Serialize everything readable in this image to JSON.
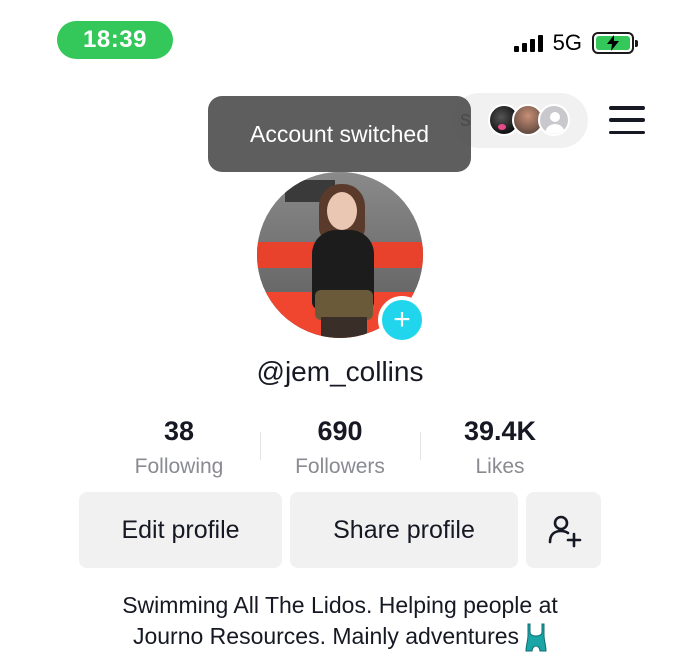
{
  "status_bar": {
    "time": "18:39",
    "network": "5G",
    "time_pill_color": "#34c759",
    "battery_color": "#34c759"
  },
  "header": {
    "account_partial_letter": "s",
    "toast": "Account switched"
  },
  "profile": {
    "username": "@jem_collins",
    "add_color": "#20d5ec"
  },
  "stats": [
    {
      "value": "38",
      "label": "Following"
    },
    {
      "value": "690",
      "label": "Followers"
    },
    {
      "value": "39.4K",
      "label": "Likes"
    }
  ],
  "actions": {
    "edit_label": "Edit profile",
    "share_label": "Share profile",
    "add_friend_icon": "add-person-icon"
  },
  "bio": {
    "line1": "Swimming All The Lidos. Helping people at",
    "line2": "Journo Resources. Mainly adventures"
  }
}
